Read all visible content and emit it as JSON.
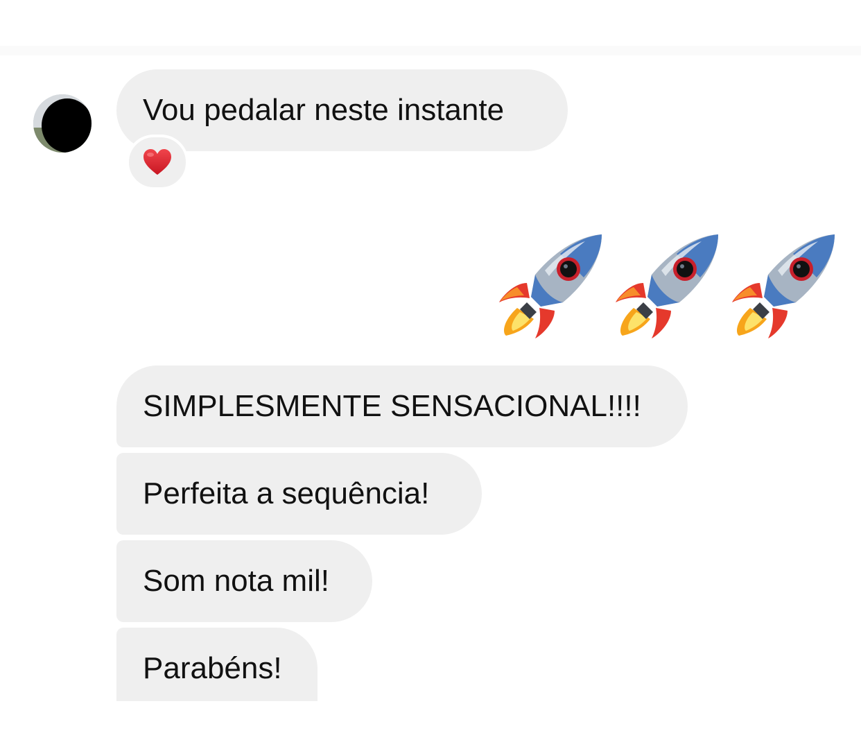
{
  "thread": {
    "messages": [
      {
        "sender": "other",
        "text": "Vou pedalar neste instante",
        "reaction": "heart"
      },
      {
        "sender": "me",
        "text": "🚀🚀🚀"
      },
      {
        "sender": "other",
        "text": "SIMPLESMENTE SENSACIONAL!!!!"
      },
      {
        "sender": "other",
        "text": "Perfeita a sequência!"
      },
      {
        "sender": "other",
        "text": "Som nota mil!"
      },
      {
        "sender": "other",
        "text": "Parabéns!"
      }
    ]
  },
  "icons": {
    "reaction": "heart-icon",
    "sent_emoji": "rocket-icon"
  },
  "colors": {
    "received_bubble": "#efefef",
    "heart": "#e0242f",
    "text": "#111111"
  }
}
